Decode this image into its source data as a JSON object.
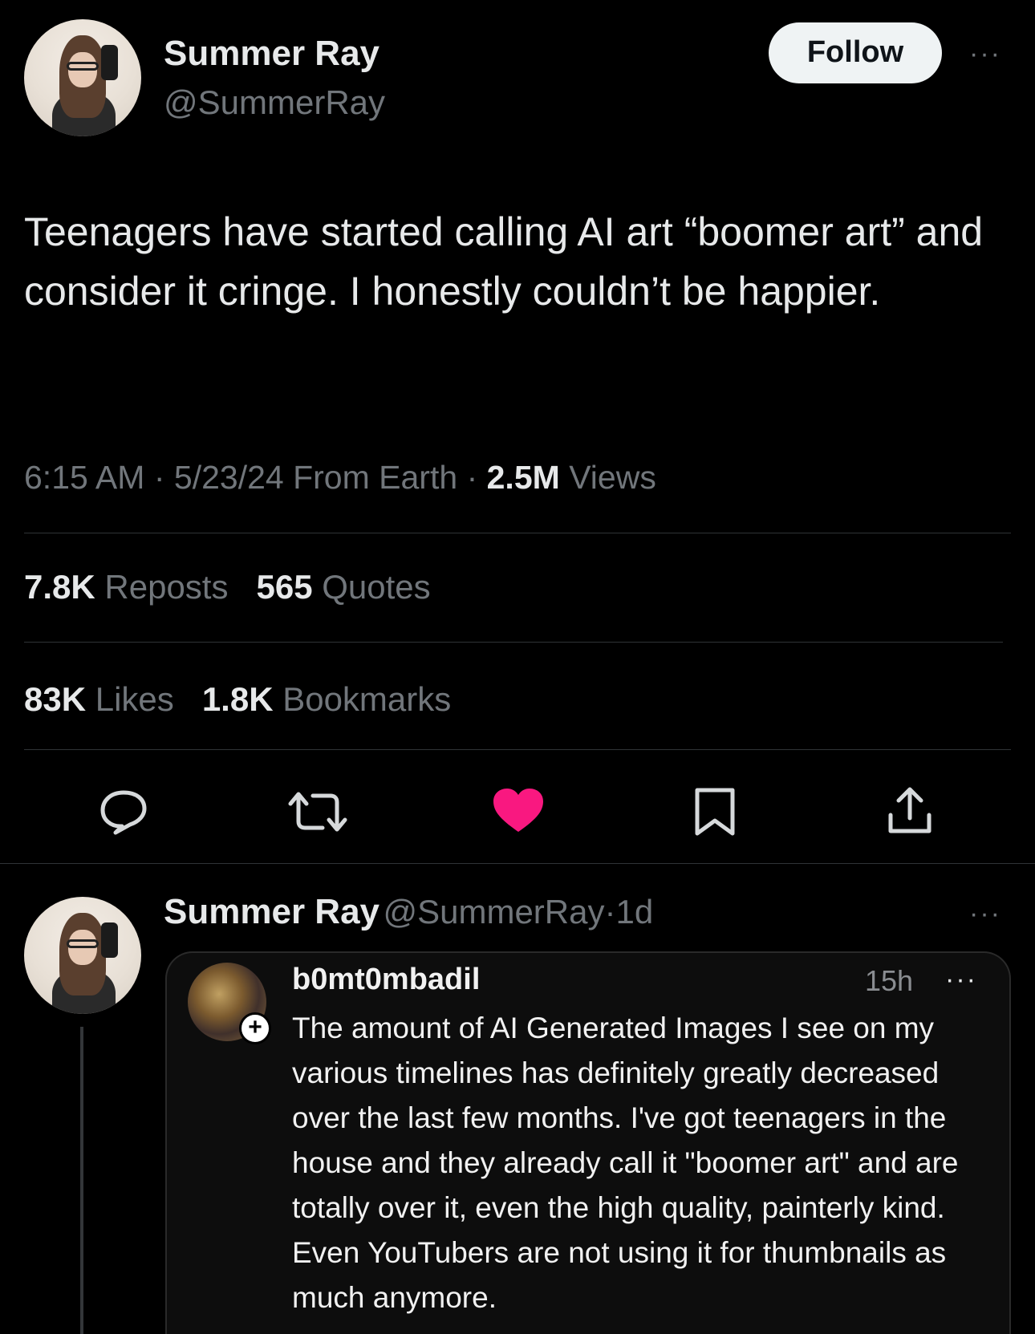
{
  "tweet": {
    "author_name": "Summer Ray",
    "author_handle": "@SummerRay",
    "follow_label": "Follow",
    "more_label": "···",
    "text": "Teenagers have started calling AI art “boomer art” and consider it cringe. I honestly couldn’t be happier.",
    "time": "6:15 AM",
    "date": "5/23/24",
    "location": "From Earth",
    "views_count": "2.5M",
    "views_label": "Views",
    "sep": "·"
  },
  "stats": {
    "reposts_count": "7.8K",
    "reposts_label": "Reposts",
    "quotes_count": "565",
    "quotes_label": "Quotes",
    "likes_count": "83K",
    "likes_label": "Likes",
    "bookmarks_count": "1.8K",
    "bookmarks_label": "Bookmarks"
  },
  "actions": {
    "icons": [
      "reply-icon",
      "repost-icon",
      "like-icon",
      "bookmark-icon",
      "share-icon"
    ],
    "like_color": "#f91880"
  },
  "reply": {
    "author_name": "Summer Ray",
    "author_handle": "@SummerRay",
    "sep": "·",
    "age": "1d",
    "more_label": "···",
    "quoted": {
      "username": "b0mt0mbadil",
      "time": "15h",
      "more_label": "···",
      "plus": "+",
      "text": "The amount of AI Generated Images I see on my various timelines has definitely greatly decreased over the last few months. I've got teenagers in the house and they already call it \"boomer art\" and are totally over it, even the high quality, painterly kind. Even YouTubers are not using it for thumbnails as much anymore."
    }
  }
}
